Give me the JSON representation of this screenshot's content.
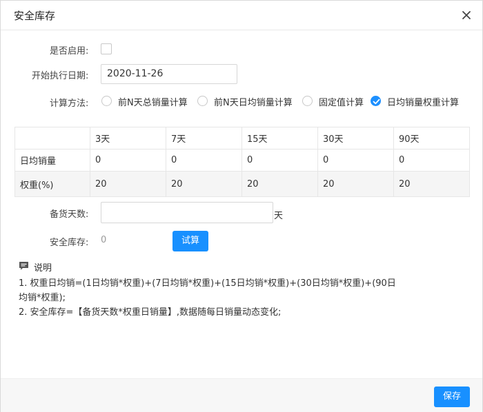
{
  "dialog": {
    "title": "安全库存"
  },
  "form": {
    "enabled_label": "是否启用:",
    "start_date_label": "开始执行日期:",
    "start_date_value": "2020-11-26",
    "calc_method_label": "计算方法:",
    "calc_methods": [
      {
        "label": "前N天总销量计算",
        "checked": false
      },
      {
        "label": "前N天日均销量计算",
        "checked": false
      },
      {
        "label": "固定值计算",
        "checked": false
      },
      {
        "label": "日均销量权重计算",
        "checked": true
      }
    ],
    "stock_days_label": "备货天数:",
    "stock_days_value": "",
    "stock_days_unit": "天",
    "safety_stock_label": "安全库存:",
    "safety_stock_value": "0",
    "calc_button": "试算"
  },
  "table": {
    "columns": [
      "",
      "3天",
      "7天",
      "15天",
      "30天",
      "90天"
    ],
    "rows": [
      {
        "label": "日均销量",
        "values": [
          "0",
          "0",
          "0",
          "0",
          "0"
        ]
      },
      {
        "label": "权重(%)",
        "values": [
          "20",
          "20",
          "20",
          "20",
          "20"
        ]
      }
    ]
  },
  "notes": {
    "title": "说明",
    "line1a": "1. 权重日均销=(1日均销*权重)+(7日均销*权重)+(15日均销*权重)+(30日均销*权重)+(90日",
    "line1b": "均销*权重);",
    "line2": "2. 安全库存=【备货天数*权重日销量】,数据随每日销量动态变化;"
  },
  "footer": {
    "save_button": "保存"
  },
  "colors": {
    "primary": "#1890ff",
    "footer_bg": "#f7f7f7",
    "table_shade": "#f5f5f5"
  }
}
